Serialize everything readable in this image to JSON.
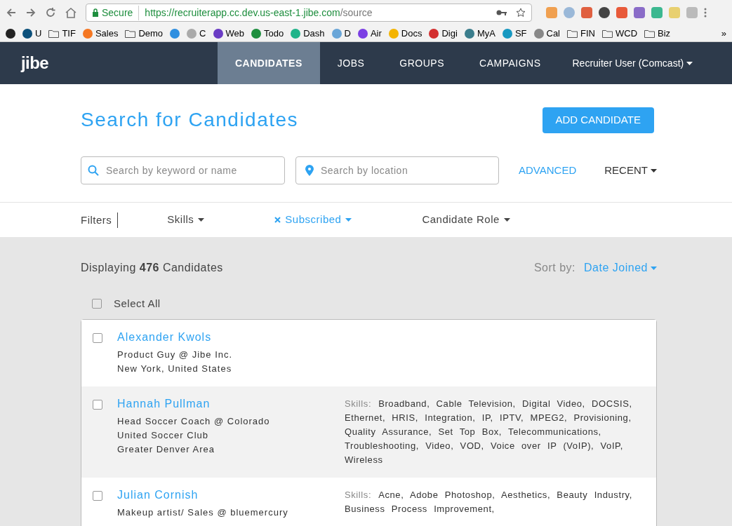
{
  "browser": {
    "secure_label": "Secure",
    "url_host": "https://recruiterapp.cc.dev.us-east-1.jibe.com",
    "url_path": "/source",
    "bookmarks": [
      {
        "kind": "site",
        "color": "#222222"
      },
      {
        "kind": "site",
        "label": "U",
        "color": "#0b4f7a"
      },
      {
        "kind": "folder",
        "label": "TIF"
      },
      {
        "kind": "site",
        "label": "Sales",
        "color": "#f57722"
      },
      {
        "kind": "folder",
        "label": "Demo"
      },
      {
        "kind": "site",
        "color": "#2f8fe0"
      },
      {
        "kind": "site",
        "label": "C",
        "color": "#aaaaaa"
      },
      {
        "kind": "site",
        "label": "Web",
        "color": "#6a3cc4"
      },
      {
        "kind": "site",
        "label": "Todo",
        "color": "#1e8e3e"
      },
      {
        "kind": "site",
        "label": "Dash",
        "color": "#20b48a"
      },
      {
        "kind": "site",
        "label": "D",
        "color": "#6aa6d8"
      },
      {
        "kind": "site",
        "label": "Air",
        "color": "#7b3fe4"
      },
      {
        "kind": "site",
        "label": "Docs",
        "color": "#f4b400"
      },
      {
        "kind": "site",
        "label": "Digi",
        "color": "#d32f2f"
      },
      {
        "kind": "site",
        "label": "MyA",
        "color": "#3a7d8c"
      },
      {
        "kind": "site",
        "label": "SF",
        "color": "#1798c1"
      },
      {
        "kind": "site",
        "label": "Cal",
        "color": "#888888"
      },
      {
        "kind": "folder",
        "label": "FIN"
      },
      {
        "kind": "folder",
        "label": "WCD"
      },
      {
        "kind": "folder",
        "label": "Biz"
      }
    ],
    "more": "»"
  },
  "nav": {
    "logo": "jibe",
    "tabs": [
      {
        "label": "CANDIDATES",
        "selected": true
      },
      {
        "label": "JOBS",
        "selected": false
      },
      {
        "label": "GROUPS",
        "selected": false
      },
      {
        "label": "CAMPAIGNS",
        "selected": false
      }
    ],
    "user": "Recruiter User (Comcast)"
  },
  "header": {
    "title": "Search for Candidates",
    "add_button": "ADD CANDIDATE",
    "keyword_placeholder": "Search by keyword or name",
    "location_placeholder": "Search by location",
    "advanced": "ADVANCED",
    "recent": "RECENT"
  },
  "filters": {
    "label": "Filters",
    "items": [
      {
        "label": "Skills",
        "active": false
      },
      {
        "label": "Subscribed",
        "active": true
      },
      {
        "label": "Candidate Role",
        "active": false
      }
    ]
  },
  "results": {
    "summary": "Displaying **476** Candidates",
    "sort_label": "Sort by:",
    "sort_value": "Date Joined",
    "select_all": {
      "label": "Select All",
      "checked": false
    }
  },
  "candidates": [
    {
      "name": "Alexander Kwols",
      "checked": false,
      "lines": [
        "Product Guy @ Jibe Inc.",
        "New York, United States"
      ]
    },
    {
      "name": "Hannah Pullman",
      "checked": false,
      "lines": [
        "Head Soccer Coach @ Colorado",
        "United Soccer Club",
        "Greater Denver Area"
      ],
      "skills_label": "Skills:",
      "skills": "Broadband, Cable Television, Digital Video, DOCSIS, Ethernet, HRIS, Integration, IP, IPTV, MPEG2, Provisioning, Quality Assurance, Set Top Box, Telecommunications, Troubleshooting, Video, VOD, Voice over IP (VoIP), VoIP, Wireless"
    },
    {
      "name": "Julian Cornish",
      "checked": false,
      "lines": [
        "Makeup artist/ Sales @ bluemercury"
      ],
      "skills_label": "Skills:",
      "skills": "Acne, Adobe Photoshop, Aesthetics, Beauty Industry, Business Process Improvement,"
    }
  ]
}
